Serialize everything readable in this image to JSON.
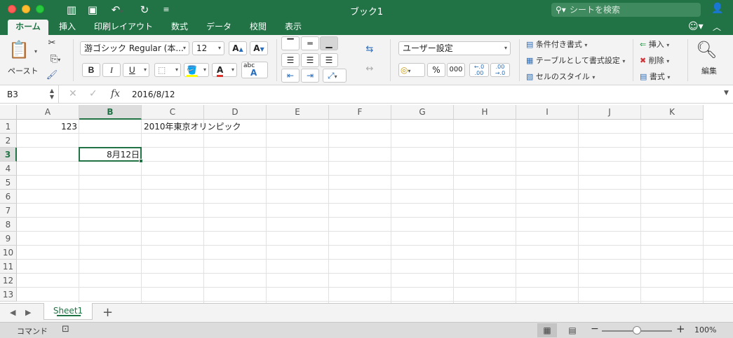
{
  "window": {
    "title": "ブック1",
    "search_placeholder": "シートを検索"
  },
  "tabs": [
    {
      "label": "ホーム",
      "active": true
    },
    {
      "label": "挿入"
    },
    {
      "label": "印刷レイアウト"
    },
    {
      "label": "数式"
    },
    {
      "label": "データ"
    },
    {
      "label": "校閲"
    },
    {
      "label": "表示"
    }
  ],
  "ribbon": {
    "paste_label": "ペースト",
    "font_name": "游ゴシック Regular (本...",
    "font_size": "12",
    "bold": "B",
    "italic": "I",
    "underline": "U",
    "wrap_abc": "abc",
    "number_format": "ユーザー設定",
    "percent": "%",
    "comma": "000",
    "conditional_format": "条件付き書式",
    "format_as_table": "テーブルとして書式設定",
    "cell_styles": "セルのスタイル",
    "insert": "挿入",
    "delete": "削除",
    "format": "書式",
    "edit": "編集",
    "accent_color": "#217346"
  },
  "formula_bar": {
    "name_box": "B3",
    "fx": "fx",
    "value": "2016/8/12"
  },
  "grid": {
    "columns": [
      "A",
      "B",
      "C",
      "D",
      "E",
      "F",
      "G",
      "H",
      "I",
      "J",
      "K"
    ],
    "rows": [
      "1",
      "2",
      "3",
      "4",
      "5",
      "6",
      "7",
      "8",
      "9",
      "10",
      "11",
      "12",
      "13"
    ],
    "selected_column": "B",
    "selected_row": "3",
    "cells": {
      "A1": "123",
      "C1": "2010年東京オリンピック",
      "B3": "8月12日"
    }
  },
  "sheets": {
    "tabs": [
      "Sheet1"
    ],
    "add": "+"
  },
  "status": {
    "mode": "コマンド",
    "zoom": "100%"
  }
}
